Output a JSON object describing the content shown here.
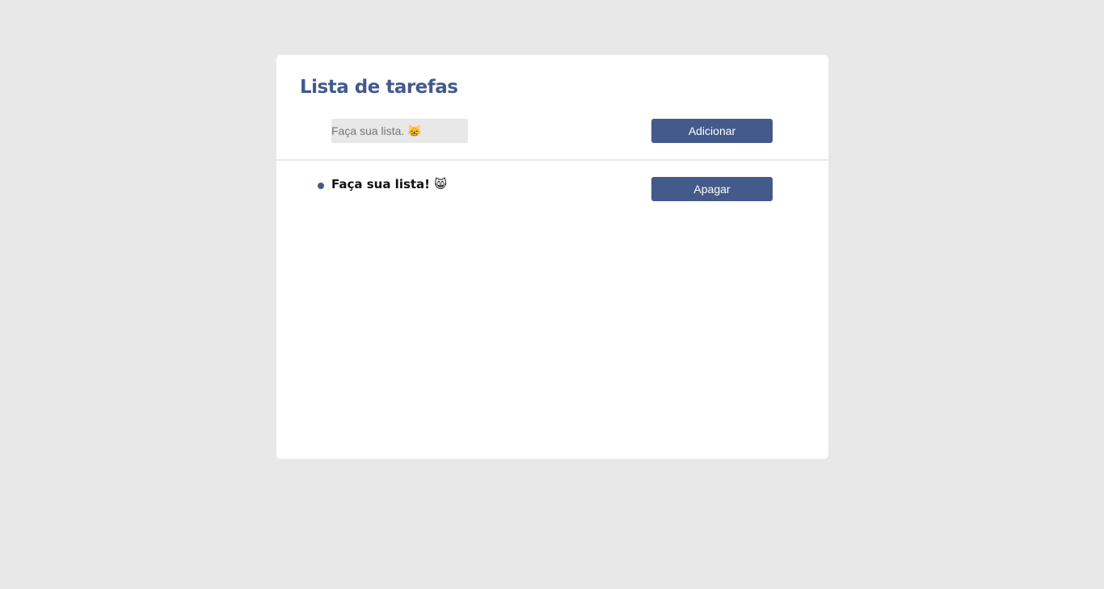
{
  "app": {
    "title": "Lista de tarefas"
  },
  "form": {
    "input_placeholder": "Faça sua lista. 😸",
    "input_value": "",
    "add_label": "Adicionar"
  },
  "tasks": [
    {
      "text": "Faça sua lista! 😸",
      "delete_label": "Apagar"
    }
  ],
  "colors": {
    "accent": "#435a8a",
    "background": "#e8e8e8",
    "card": "#ffffff"
  }
}
